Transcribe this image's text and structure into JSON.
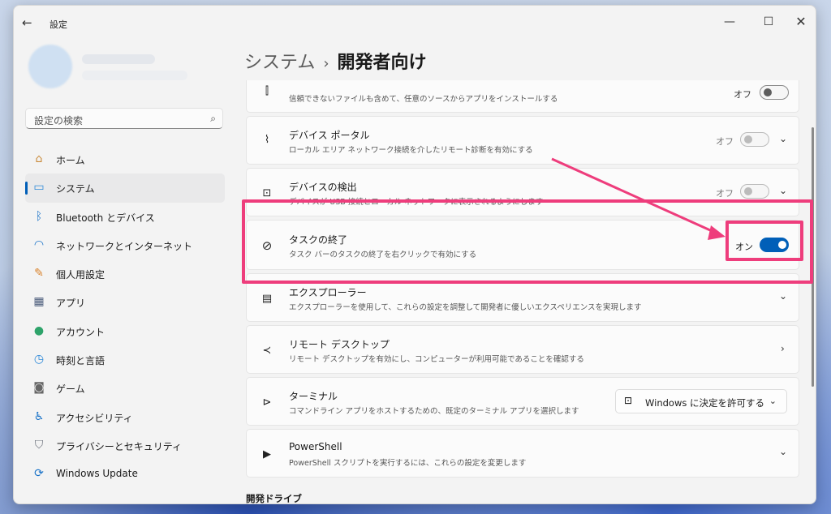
{
  "window": {
    "title": "設定",
    "back_icon": "arrow-left-icon",
    "controls": {
      "minimize": "—",
      "maximize": "☐",
      "close": "✕"
    }
  },
  "sidebar": {
    "search_placeholder": "設定の検索",
    "items": [
      {
        "label": "ホーム",
        "icon": "home-icon",
        "active": false
      },
      {
        "label": "システム",
        "icon": "monitor-icon",
        "active": true
      },
      {
        "label": "Bluetooth とデバイス",
        "icon": "bluetooth-icon",
        "active": false
      },
      {
        "label": "ネットワークとインターネット",
        "icon": "wifi-icon",
        "active": false
      },
      {
        "label": "個人用設定",
        "icon": "brush-icon",
        "active": false
      },
      {
        "label": "アプリ",
        "icon": "apps-icon",
        "active": false
      },
      {
        "label": "アカウント",
        "icon": "person-icon",
        "active": false
      },
      {
        "label": "時刻と言語",
        "icon": "globe-clock-icon",
        "active": false
      },
      {
        "label": "ゲーム",
        "icon": "gamepad-icon",
        "active": false
      },
      {
        "label": "アクセシビリティ",
        "icon": "accessibility-icon",
        "active": false
      },
      {
        "label": "プライバシーとセキュリティ",
        "icon": "shield-icon",
        "active": false
      },
      {
        "label": "Windows Update",
        "icon": "update-icon",
        "active": false
      }
    ]
  },
  "breadcrumb": {
    "parent": "システム",
    "separator": "›",
    "current": "開発者向け"
  },
  "cards": {
    "developer_mode": {
      "desc": "信頼できないファイルも含めて、任意のソースからアプリをインストールする",
      "state": "オフ"
    },
    "device_portal": {
      "title": "デバイス ポータル",
      "desc": "ローカル エリア ネットワーク接続を介したリモート診断を有効にする",
      "state": "オフ"
    },
    "device_discovery": {
      "title": "デバイスの検出",
      "desc": "デバイスが USB 接続とローカル ネットワークに表示されるようにします",
      "state": "オフ"
    },
    "end_task": {
      "title": "タスクの終了",
      "desc": "タスク バーのタスクの終了を右クリックで有効にする",
      "state": "オン"
    },
    "explorer": {
      "title": "エクスプローラー",
      "desc": "エクスプローラーを使用して、これらの設定を調整して開発者に優しいエクスペリエンスを実現します"
    },
    "remote_desktop": {
      "title": "リモート デスクトップ",
      "desc": "リモート デスクトップを有効にし、コンピューターが利用可能であることを確認する"
    },
    "terminal": {
      "title": "ターミナル",
      "desc": "コマンドライン アプリをホストするための、既定のターミナル アプリを選択します",
      "dropdown_value": "Windows に決定を許可する"
    },
    "powershell": {
      "title": "PowerShell",
      "desc": "PowerShell スクリプトを実行するには、これらの設定を変更します"
    }
  },
  "section": {
    "dev_drive": "開発ドライブ"
  },
  "colors": {
    "accent": "#005fb8",
    "annotation": "#ee3d7c"
  }
}
